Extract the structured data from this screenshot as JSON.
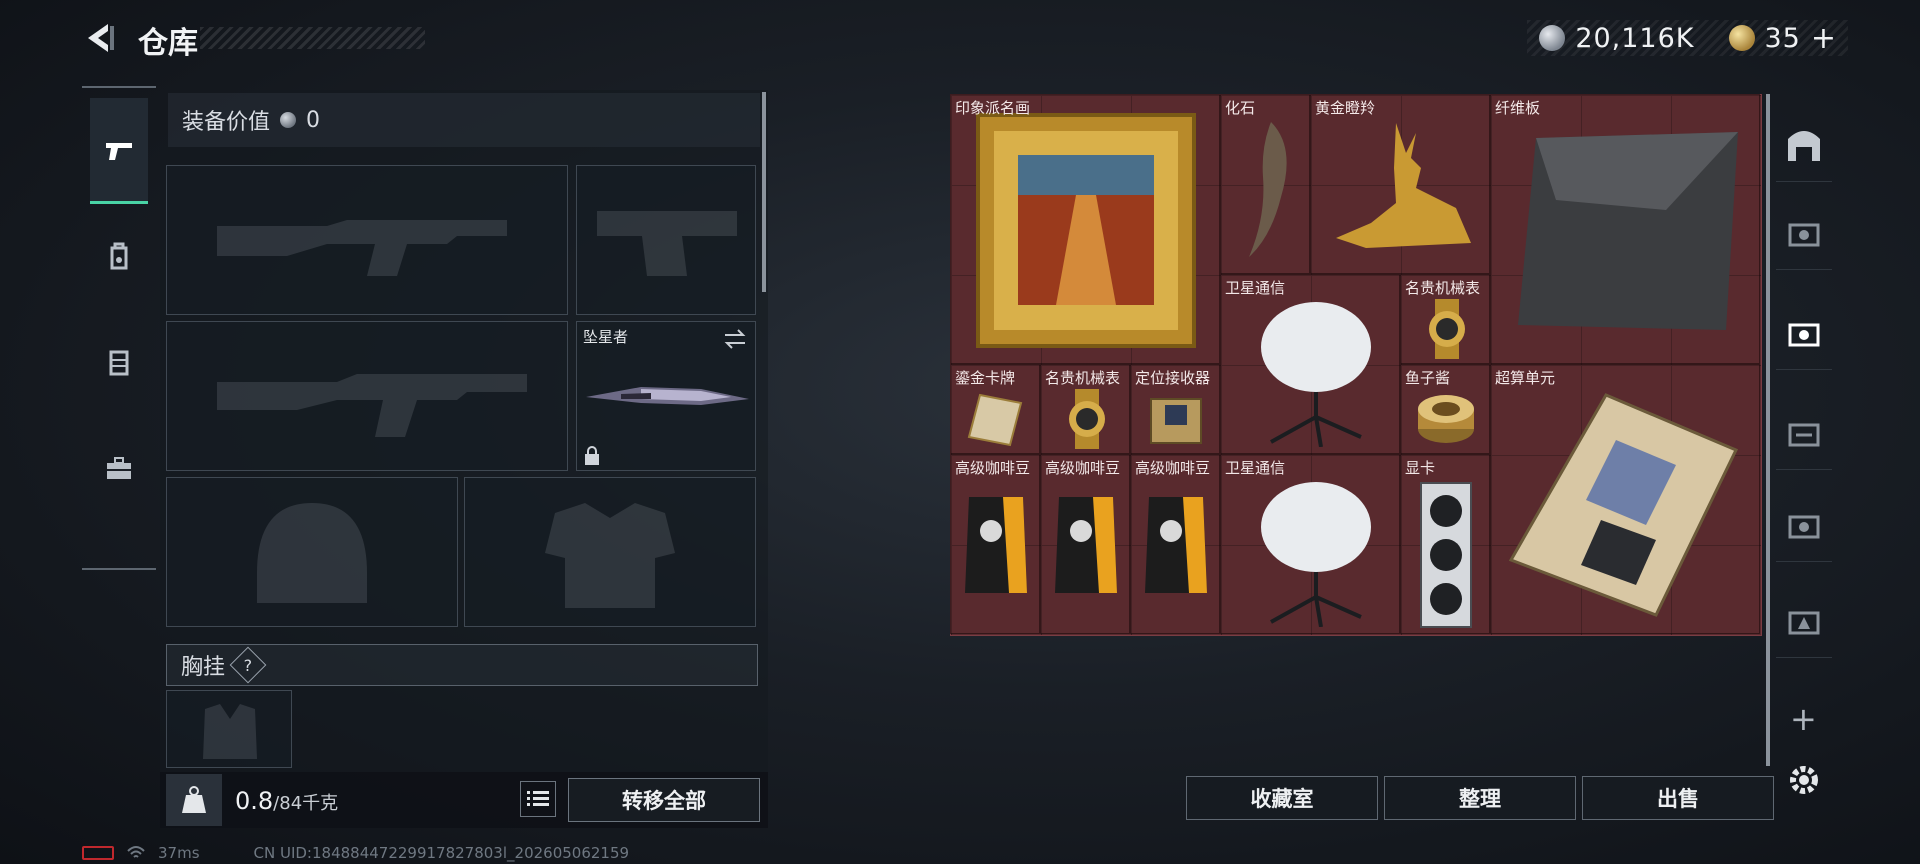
{
  "header": {
    "title": "仓库",
    "currency_silver": "20,116K",
    "currency_gold": "35",
    "plus": "+"
  },
  "equipment": {
    "value_label": "装备价值",
    "value": "0",
    "melee_name": "坠星者",
    "chest_label": "胸挂",
    "help": "?"
  },
  "footer_left": {
    "weight_current": "0.8",
    "weight_max": "/84千克",
    "transfer_all": "转移全部"
  },
  "storage": {
    "items": [
      {
        "name": "印象派名画"
      },
      {
        "name": "化石"
      },
      {
        "name": "黄金瞪羚"
      },
      {
        "name": "纤维板"
      },
      {
        "name": "卫星通信"
      },
      {
        "name": "名贵机械表"
      },
      {
        "name": "鎏金卡牌"
      },
      {
        "name": "名贵机械表"
      },
      {
        "name": "定位接收器"
      },
      {
        "name": "鱼子酱"
      },
      {
        "name": "超算单元"
      },
      {
        "name": "高级咖啡豆"
      },
      {
        "name": "高级咖啡豆"
      },
      {
        "name": "高级咖啡豆"
      },
      {
        "name": "卫星通信"
      },
      {
        "name": "显卡"
      }
    ]
  },
  "buttons": {
    "collection": "收藏室",
    "organize": "整理",
    "sell": "出售"
  },
  "status": {
    "ping": "37ms",
    "uid": "CN UID:18488447229917827803l_202605062159"
  },
  "colors": {
    "grid_bg": "#5a2a2f",
    "accent": "#49d3a5"
  }
}
